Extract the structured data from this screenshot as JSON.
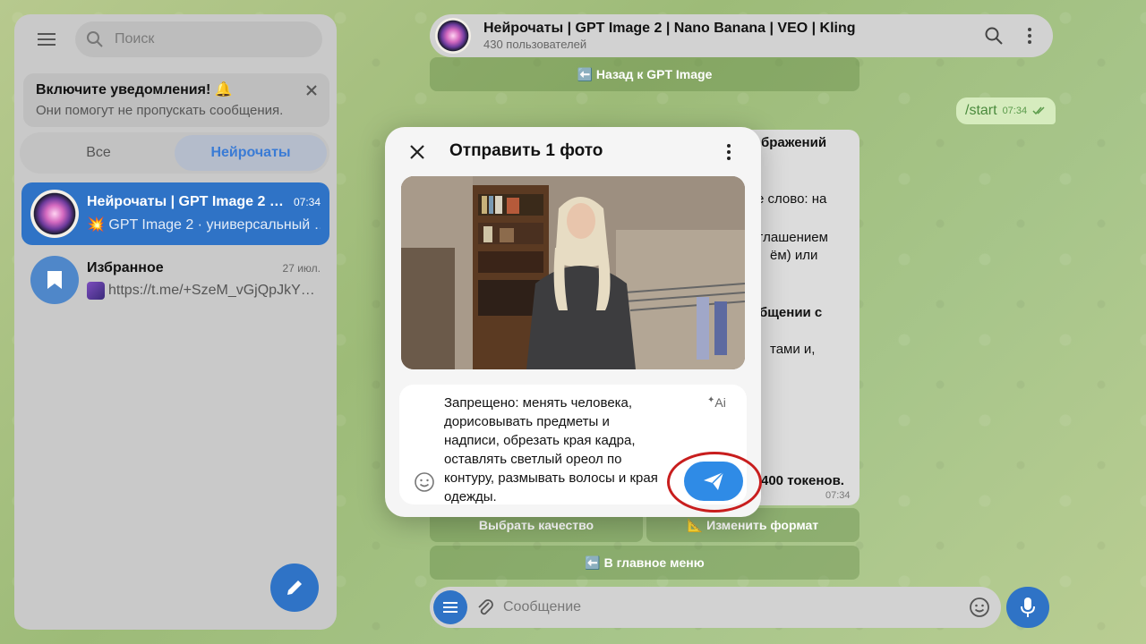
{
  "sidebar": {
    "search_placeholder": "Поиск",
    "notice": {
      "title": "Включите уведомления! 🔔",
      "text": "Они помогут не пропускать сообщения."
    },
    "tabs": [
      {
        "label": "Все"
      },
      {
        "label": "Нейрочаты"
      }
    ],
    "chats": [
      {
        "name": "Нейрочаты | GPT Image 2 | …",
        "time": "07:34",
        "message": "💥 GPT Image 2 · универсальный …"
      },
      {
        "name": "Избранное",
        "time": "27 июл.",
        "message": "https://t.me/+SzeM_vGjQpJkY…"
      }
    ]
  },
  "header": {
    "title": "Нейрочаты | GPT Image 2 | Nano Banana | VEO | Kling",
    "subtitle": "430 пользователей"
  },
  "keyboard": {
    "back_gpt": "⬅️ Назад к GPT Image",
    "quality": "Выбрать качество",
    "format": "📐 Изменить формат",
    "main_menu": "⬅️ В главное меню"
  },
  "messages": {
    "outgoing": {
      "text": "/start",
      "time": "07:34"
    },
    "incoming_fragments": [
      "бражений",
      "е слово: на",
      "глашением",
      "ём) или",
      "бщении с",
      "тами и,",
      "400 токенов."
    ],
    "incoming_time": "07:34"
  },
  "composer": {
    "placeholder": "Сообщение"
  },
  "modal": {
    "title": "Отправить 1 фото",
    "caption_lines": [
      "Запрещено: менять человека,",
      "дорисовывать предметы и",
      "надписи, обрезать края кадра,",
      "оставлять светлый ореол по",
      "контуру, размывать волосы и края",
      "одежды."
    ],
    "ai_label": "Ai"
  },
  "colors": {
    "accent": "#2f73c6",
    "send": "#2f8be6",
    "highlight": "#c81e1e"
  }
}
